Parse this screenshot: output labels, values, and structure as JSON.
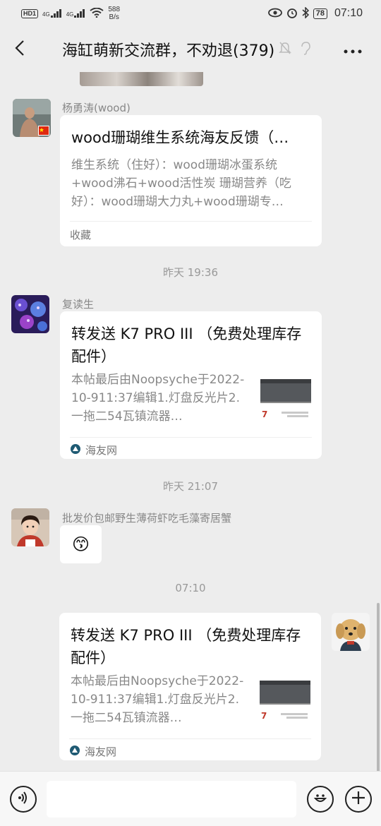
{
  "status_bar": {
    "hd_label": "HD",
    "hd_sub": "1",
    "net1": "4G",
    "net2": "4G",
    "speed_value": "588",
    "speed_unit": "B/s",
    "battery": "78",
    "time": "07:10"
  },
  "nav": {
    "title": "海缸萌新交流群，不劝退(379)"
  },
  "messages": [
    {
      "sender": "杨勇涛(wood)",
      "card_title": "wood珊瑚维生系统海友反馈（…",
      "card_desc": "维生系统（住好）：wood珊瑚冰蛋系统+wood沸石+wood活性炭 珊瑚营养（吃好）：wood珊瑚大力丸+wood珊瑚专…",
      "footer": "收藏"
    },
    {
      "time": "昨天 19:36"
    },
    {
      "sender": "复读生",
      "card_title": "转发送 K7 PRO III （免费处理库存配件）",
      "card_desc": "本帖最后由Noopsyche于2022-10-911:37编辑1.灯盘反光片2.一拖二54瓦镇流器…",
      "footer": "海友网"
    },
    {
      "time": "昨天 21:07"
    },
    {
      "sender": "批发价包邮野生薄荷虾吃毛藻寄居蟹",
      "emoji": "😙"
    },
    {
      "time": "07:10"
    },
    {
      "card_title": "转发送 K7 PRO III （免费处理库存配件）",
      "card_desc": "本帖最后由Noopsyche于2022-10-911:37编辑1.灯盘反光片2.一拖二54瓦镇流器…",
      "footer": "海友网"
    }
  ],
  "input": {
    "value": ""
  },
  "icons": {
    "back": "chevron-left-icon",
    "mute": "bell-off-icon",
    "ear": "ear-icon",
    "more": "more-icon",
    "voice": "voice-icon",
    "emoji": "emoji-icon",
    "plus": "plus-icon"
  }
}
